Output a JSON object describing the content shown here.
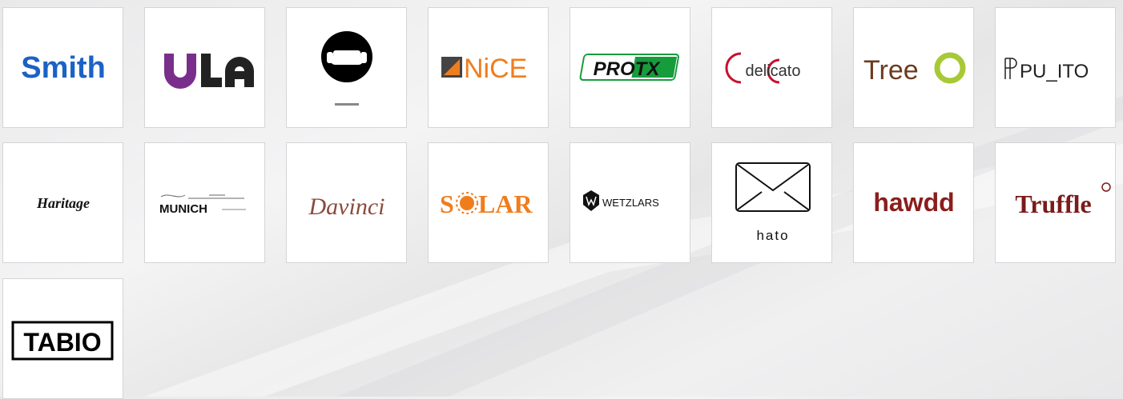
{
  "brands": [
    {
      "name": "Smith",
      "text": "Smith",
      "color": "#1b62c6"
    },
    {
      "name": "ULA",
      "text": "ULA",
      "color": "#7a2e8c"
    },
    {
      "name": "Unknown sofa",
      "text": "",
      "color": "#000000"
    },
    {
      "name": "NiCE",
      "text": "NiCE",
      "color": "#f07d1d"
    },
    {
      "name": "PROTX",
      "text": "PROTX",
      "color": "#179c3c"
    },
    {
      "name": "delicato",
      "text": "delicato",
      "color": "#c8102e"
    },
    {
      "name": "TreeO",
      "text": "Tree",
      "color": "#6b3b1e"
    },
    {
      "name": "PULITO",
      "text": "PU_ITO",
      "color": "#222222"
    },
    {
      "name": "Haritage",
      "text": "Haritage",
      "color": "#111111"
    },
    {
      "name": "MUNICH",
      "text": "MUNICH",
      "color": "#111111"
    },
    {
      "name": "Davinci",
      "text": "Davinci",
      "color": "#8a4b3c"
    },
    {
      "name": "SOLAR",
      "text": "S",
      "text2": "LAR",
      "color": "#f07d1d"
    },
    {
      "name": "WETZLARS",
      "text": "WETZLARS",
      "color": "#111111"
    },
    {
      "name": "hato",
      "text": "hato",
      "color": "#111111"
    },
    {
      "name": "hawdd",
      "text": "hawdd",
      "color": "#8b1d1d"
    },
    {
      "name": "Truffle",
      "text": "Truffle",
      "color": "#7a1b1b"
    },
    {
      "name": "TABIO",
      "text": "TABIO",
      "color": "#000000"
    }
  ]
}
